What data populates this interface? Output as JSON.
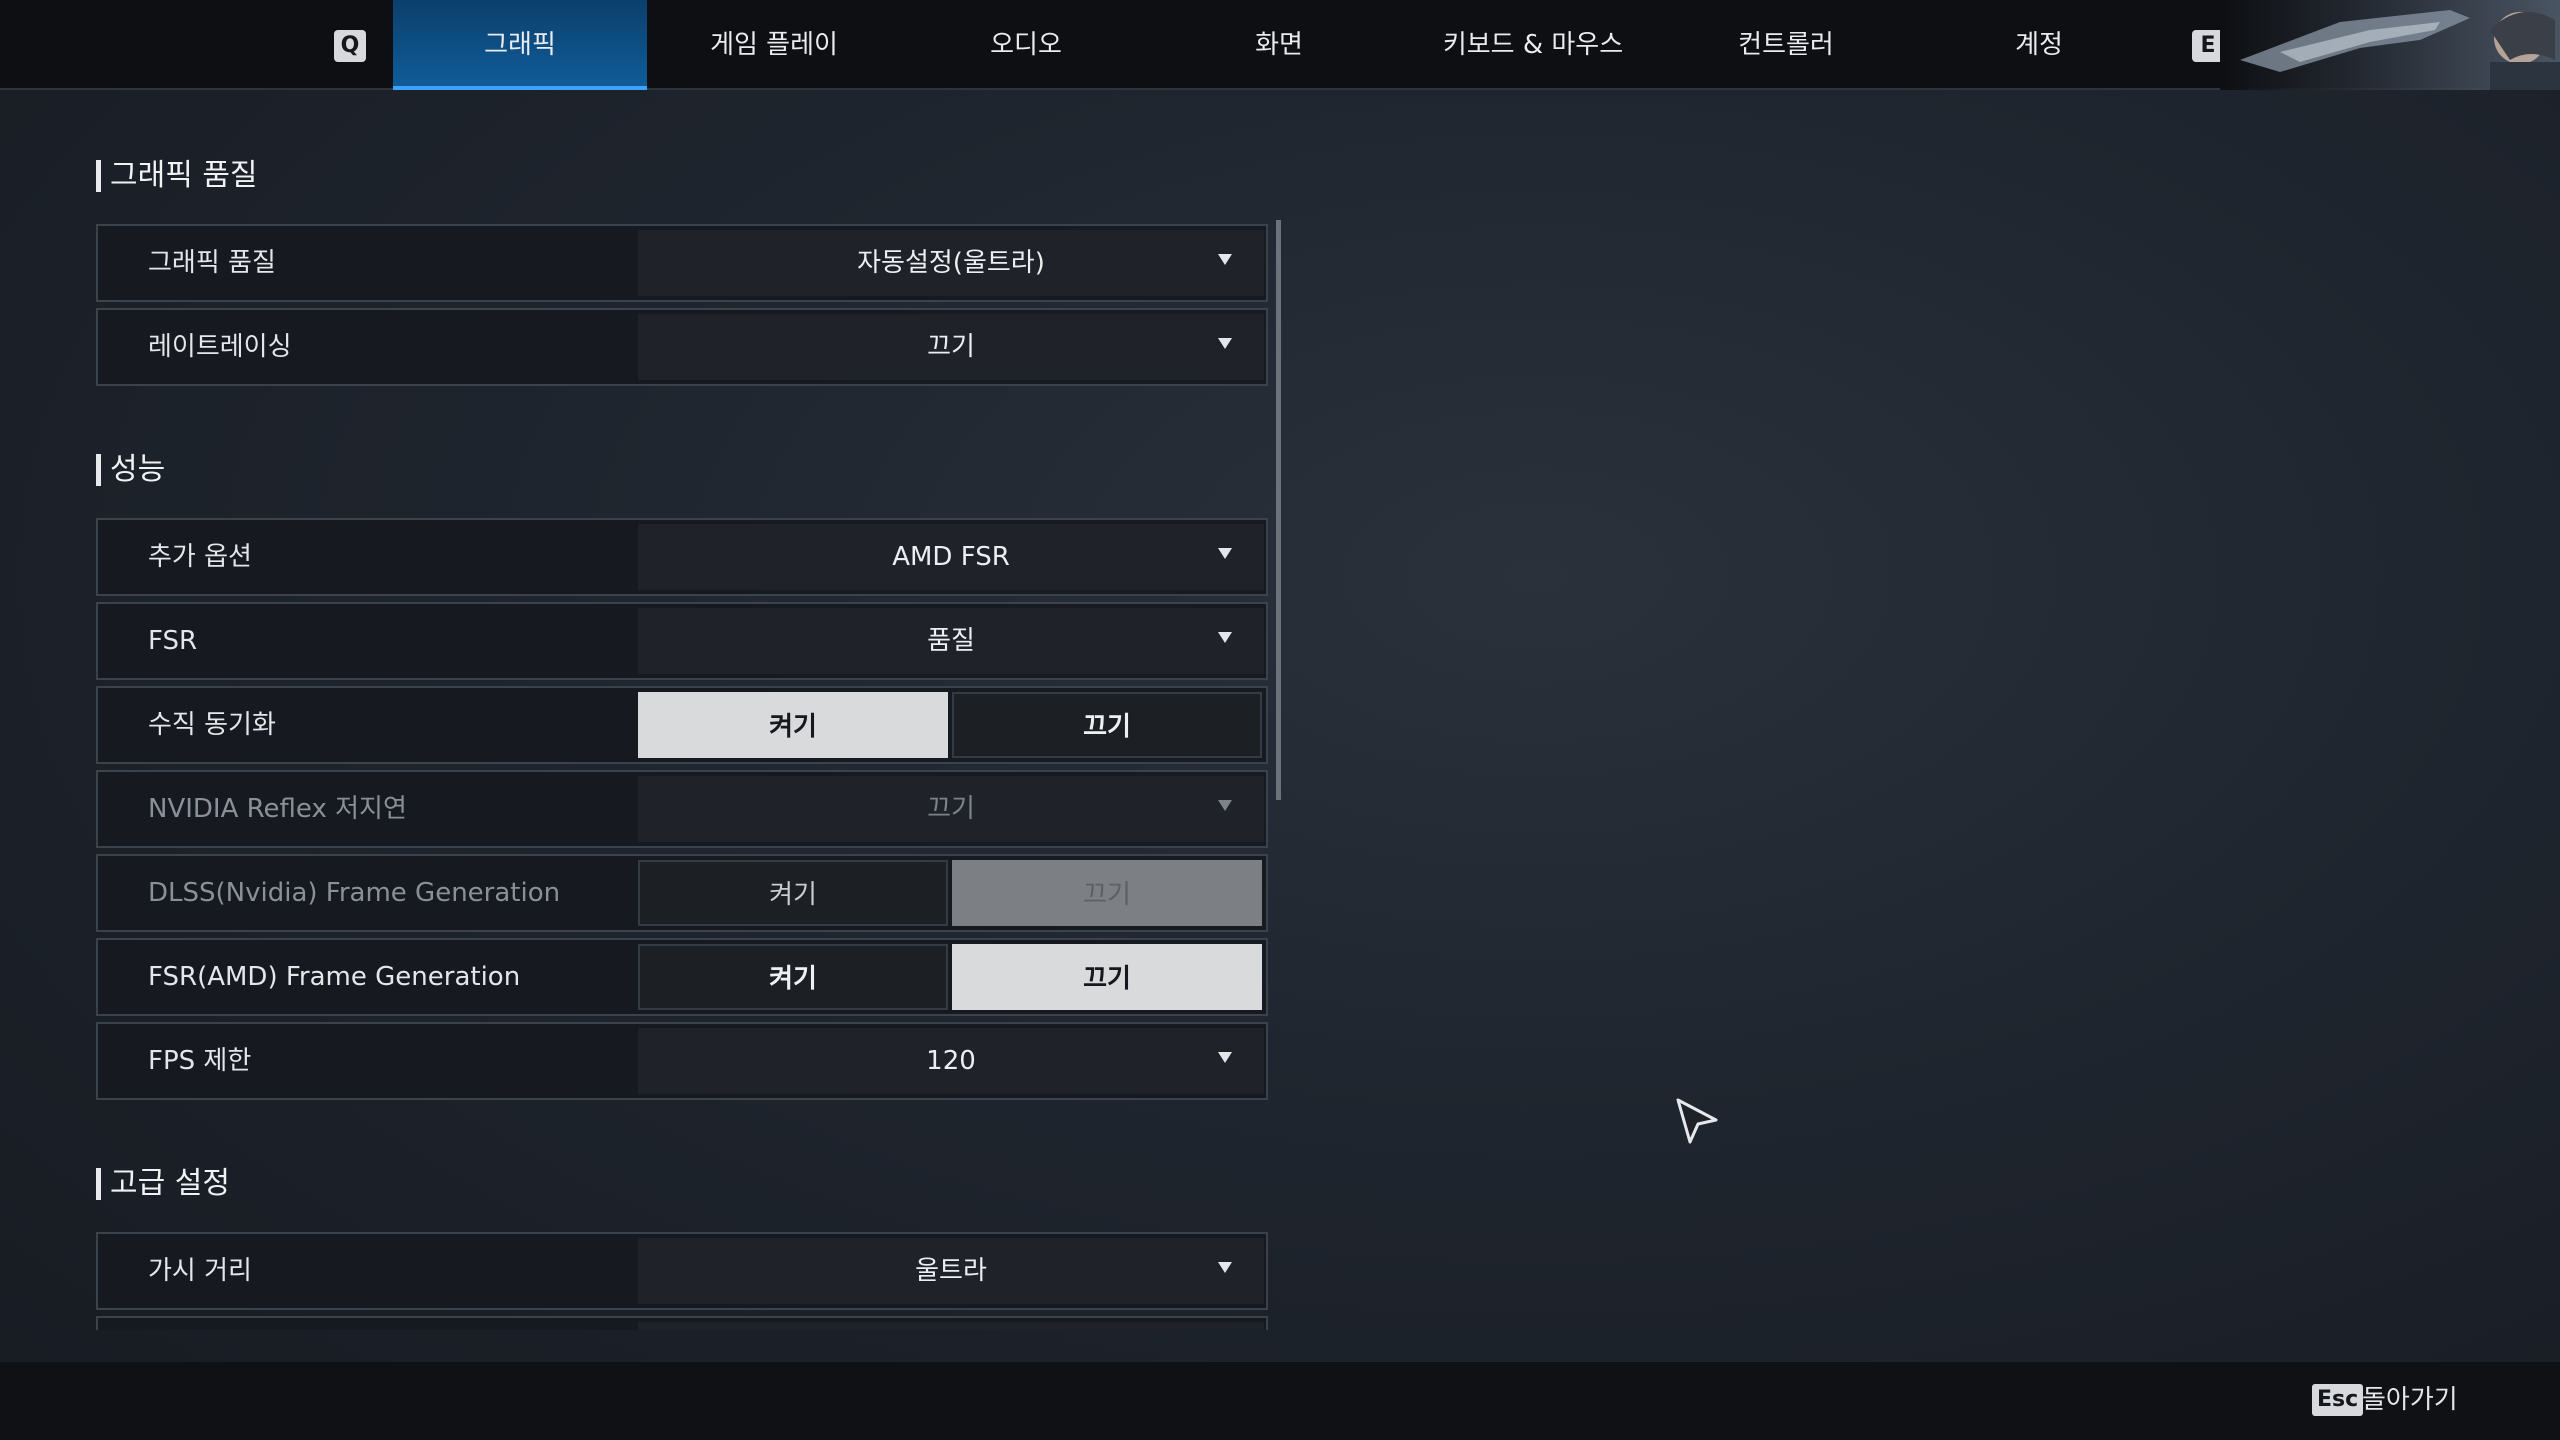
{
  "nav": {
    "prev_key": "Q",
    "next_key": "E",
    "tabs": [
      {
        "label": "그래픽"
      },
      {
        "label": "게임 플레이"
      },
      {
        "label": "오디오"
      },
      {
        "label": "화면"
      },
      {
        "label": "키보드 & 마우스"
      },
      {
        "label": "컨트롤러"
      },
      {
        "label": "계정"
      }
    ],
    "active_tab": "그래픽"
  },
  "sections": {
    "graphics_quality": {
      "title": "그래픽 품질",
      "rows": {
        "quality": {
          "label": "그래픽 품질",
          "value": "자동설정(울트라)"
        },
        "raytracing": {
          "label": "레이트레이싱",
          "value": "끄기"
        }
      }
    },
    "performance": {
      "title": "성능",
      "rows": {
        "extra_option": {
          "label": "추가 옵션",
          "value": "AMD FSR"
        },
        "fsr": {
          "label": "FSR",
          "value": "품질"
        },
        "vsync": {
          "label": "수직 동기화",
          "on": "켜기",
          "off": "끄기",
          "selected": "켜기"
        },
        "reflex": {
          "label": "NVIDIA Reflex 저지연",
          "value": "끄기",
          "disabled": true
        },
        "dlss_fg": {
          "label": "DLSS(Nvidia) Frame Generation",
          "on": "켜기",
          "off": "끄기",
          "selected": "끄기",
          "disabled": true
        },
        "fsr_fg": {
          "label": "FSR(AMD) Frame Generation",
          "on": "켜기",
          "off": "끄기",
          "selected": "끄기"
        },
        "fps_limit": {
          "label": "FPS 제한",
          "value": "120"
        }
      }
    },
    "advanced": {
      "title": "고급 설정",
      "rows": {
        "view_distance": {
          "label": "가시 거리",
          "value": "울트라"
        }
      }
    }
  },
  "footer": {
    "esc_key": "Esc",
    "back_label": "돌아가기"
  },
  "colors": {
    "accent": "#3fa2ff",
    "active_tab": "#0f5c99",
    "selected_toggle": "#d9dadc"
  }
}
